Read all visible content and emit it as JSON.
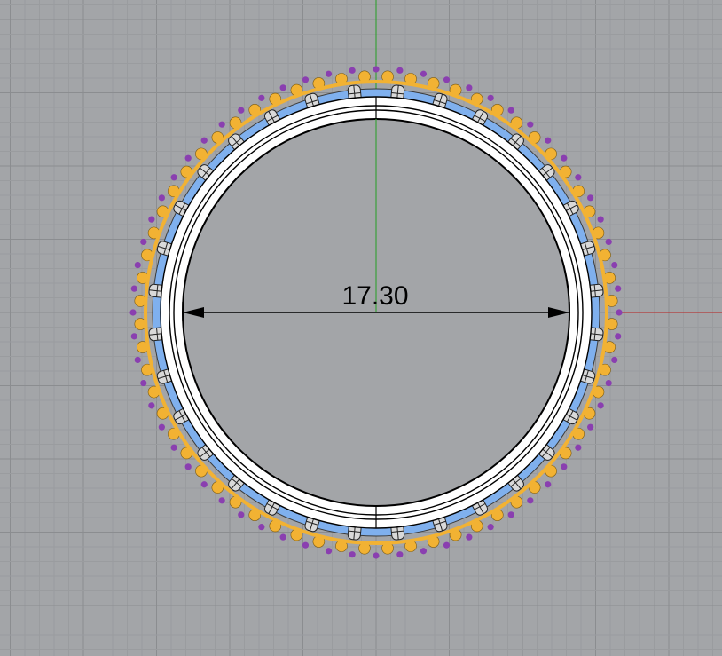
{
  "viewport": {
    "background": "#a3a5a8",
    "grid_minor_color": "#9a9c9f",
    "grid_major_color": "#8b8d90",
    "axis_x_color": "#b33a3a",
    "axis_y_color": "#3aa03a"
  },
  "ring": {
    "band_color": "#ffffff",
    "outline_color": "#000000",
    "channel_color": "#7fb0ee",
    "outer_stone_color": "#f2b233",
    "accent_stone_color": "#8a3fb0",
    "prong_color": "#d9d9d9",
    "stone_count": 32
  },
  "dimension": {
    "label": "17.30",
    "line_color": "#000000"
  }
}
